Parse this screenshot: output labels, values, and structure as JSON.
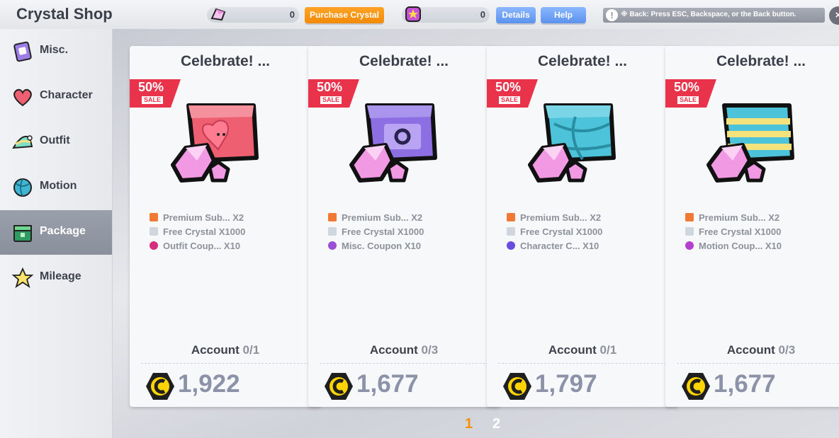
{
  "header": {
    "title": "Crystal Shop",
    "crystal_count": "0",
    "purchase_label": "Purchase Crystal",
    "mileage_count": "0",
    "details_label": "Details",
    "help_label": "Help",
    "hint_text": "※ Back: Press ESC, Backspace, or the Back button.",
    "close_glyph": "×"
  },
  "sidebar": {
    "items": [
      {
        "label": "Misc.",
        "icon": "misc-icon",
        "active": false
      },
      {
        "label": "Character",
        "icon": "heart-icon",
        "active": false
      },
      {
        "label": "Outfit",
        "icon": "hat-icon",
        "active": false
      },
      {
        "label": "Motion",
        "icon": "ball-icon",
        "active": false
      },
      {
        "label": "Package",
        "icon": "package-icon",
        "active": true
      },
      {
        "label": "Mileage",
        "icon": "star-icon",
        "active": false
      }
    ]
  },
  "cards": [
    {
      "title": "Celebrate! ...",
      "sale_pct": "50%",
      "sale_label": "SALE",
      "box_color": "#ef5f72",
      "box_icon": "heart",
      "items": [
        {
          "text": "Premium Sub... X2",
          "icon_color": "#f07a35"
        },
        {
          "text": "Free Crystal X1000",
          "icon_color": "#cfd6dd"
        },
        {
          "text": "Outfit Coup... X10",
          "icon_color": "#d52d80"
        }
      ],
      "account_label": "Account",
      "account_count": "0/1",
      "price": "1,922"
    },
    {
      "title": "Celebrate! ...",
      "sale_pct": "50%",
      "sale_label": "SALE",
      "box_color": "#8d6fe3",
      "box_icon": "cat",
      "items": [
        {
          "text": "Premium Sub... X2",
          "icon_color": "#f07a35"
        },
        {
          "text": "Free Crystal X1000",
          "icon_color": "#cfd6dd"
        },
        {
          "text": "Misc. Coupon X10",
          "icon_color": "#9b4fd9"
        }
      ],
      "account_label": "Account",
      "account_count": "0/3",
      "price": "1,677"
    },
    {
      "title": "Celebrate! ...",
      "sale_pct": "50%",
      "sale_label": "SALE",
      "box_color": "#4cc3d9",
      "box_icon": "ball",
      "items": [
        {
          "text": "Premium Sub... X2",
          "icon_color": "#f07a35"
        },
        {
          "text": "Free Crystal X1000",
          "icon_color": "#cfd6dd"
        },
        {
          "text": "Character C... X10",
          "icon_color": "#6a4ce0"
        }
      ],
      "account_label": "Account",
      "account_count": "0/1",
      "price": "1,797"
    },
    {
      "title": "Celebrate! ...",
      "sale_pct": "50%",
      "sale_label": "SALE",
      "box_color": "#4cc3d9",
      "box_icon": "stripes",
      "items": [
        {
          "text": "Premium Sub... X2",
          "icon_color": "#f07a35"
        },
        {
          "text": "Free Crystal X1000",
          "icon_color": "#cfd6dd"
        },
        {
          "text": "Motion Coup... X10",
          "icon_color": "#b43fd0"
        }
      ],
      "account_label": "Account",
      "account_count": "0/3",
      "price": "1,677"
    }
  ],
  "pagination": {
    "pages": [
      "1",
      "2"
    ],
    "current": "1"
  },
  "colors": {
    "accent_orange": "#f5900f",
    "accent_blue": "#6c9ff2",
    "sale_red": "#e8334a",
    "price_gray": "#8c92a8"
  }
}
